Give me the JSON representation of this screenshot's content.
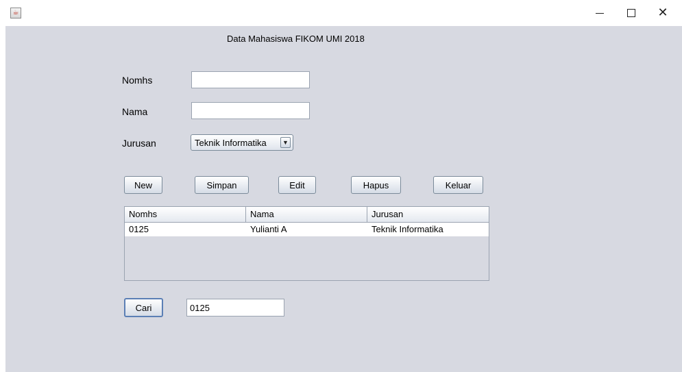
{
  "window": {
    "icon": "java-icon",
    "controls": [
      "minimize",
      "maximize",
      "close"
    ]
  },
  "heading": "Data Mahasiswa FIKOM UMI 2018",
  "form": {
    "nomhs_label": "Nomhs",
    "nomhs_value": "",
    "nama_label": "Nama",
    "nama_value": "",
    "jurusan_label": "Jurusan",
    "jurusan_selected": "Teknik Informatika"
  },
  "buttons": {
    "new": "New",
    "simpan": "Simpan",
    "edit": "Edit",
    "hapus": "Hapus",
    "keluar": "Keluar",
    "cari": "Cari"
  },
  "table": {
    "columns": [
      "Nomhs",
      "Nama",
      "Jurusan"
    ],
    "rows": [
      [
        "0125",
        "Yulianti A",
        "Teknik Informatika"
      ]
    ]
  },
  "search": {
    "value": "0125"
  }
}
